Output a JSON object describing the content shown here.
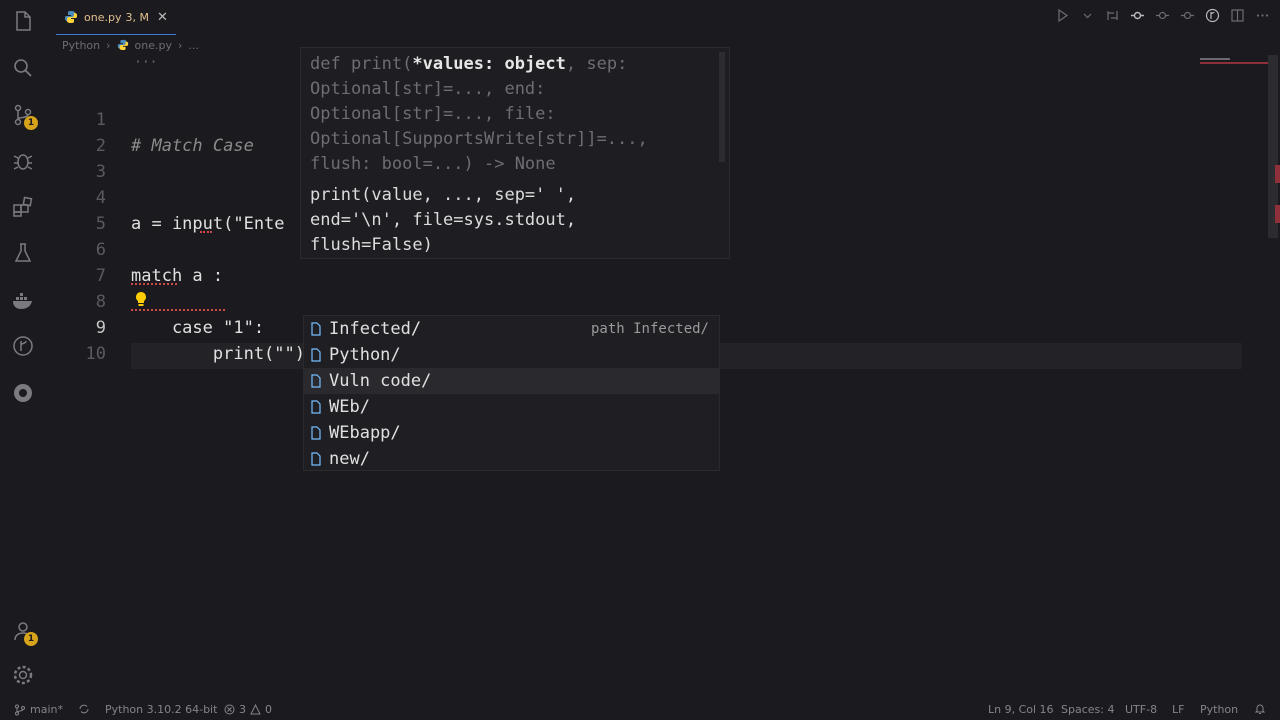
{
  "tab": {
    "filename": "one.py",
    "status": "3, M"
  },
  "breadcrumb": {
    "folder": "Python",
    "file": "one.py",
    "more": "..."
  },
  "editor": {
    "folded_marker": "···",
    "lines": [
      {
        "number": "1",
        "text": "# Match Case"
      },
      {
        "number": "2",
        "text": ""
      },
      {
        "number": "3",
        "text": ""
      },
      {
        "number": "4",
        "text": "a = input(\"Ente"
      },
      {
        "number": "5",
        "text": ""
      },
      {
        "number": "6",
        "text": "match a :"
      },
      {
        "number": "7",
        "text": ""
      },
      {
        "number": "8",
        "text": "    case \"1\":"
      },
      {
        "number": "9",
        "text": "        print(\"\")"
      },
      {
        "number": "10",
        "text": ""
      }
    ]
  },
  "signature_popup": {
    "sig_prefix": "def print(",
    "sig_param": "*values: object",
    "sig_rest_1": ", sep:",
    "sig_line_2": "Optional[str]=..., end:",
    "sig_line_3": "Optional[str]=..., file:",
    "sig_line_4": "Optional[SupportsWrite[str]]=...,",
    "sig_line_5": "flush: bool=...) -> None",
    "doc_line_1": "print(value, ..., sep=' ',",
    "doc_line_2": "end='\\n', file=sys.stdout,",
    "doc_line_3": "flush=False)"
  },
  "suggestions": [
    {
      "label": "Infected/",
      "detail": "path Infected/"
    },
    {
      "label": "Python/",
      "detail": ""
    },
    {
      "label": "Vuln code/",
      "detail": ""
    },
    {
      "label": "WEb/",
      "detail": ""
    },
    {
      "label": "WEbapp/",
      "detail": ""
    },
    {
      "label": "new/",
      "detail": ""
    }
  ],
  "activity_badges": {
    "source_control": "1",
    "accounts": "1"
  },
  "statusbar": {
    "branch": "main*",
    "interpreter": "Python 3.10.2 64-bit",
    "errors": "3",
    "warnings": "0",
    "cursor": "Ln 9, Col 16",
    "spaces": "Spaces: 4",
    "encoding": "UTF-8",
    "eol": "LF",
    "language": "Python"
  },
  "colors": {
    "accent": "#3b7bd6",
    "modified": "#e2c08d",
    "badge": "#d7a31a",
    "error": "#d04848"
  }
}
